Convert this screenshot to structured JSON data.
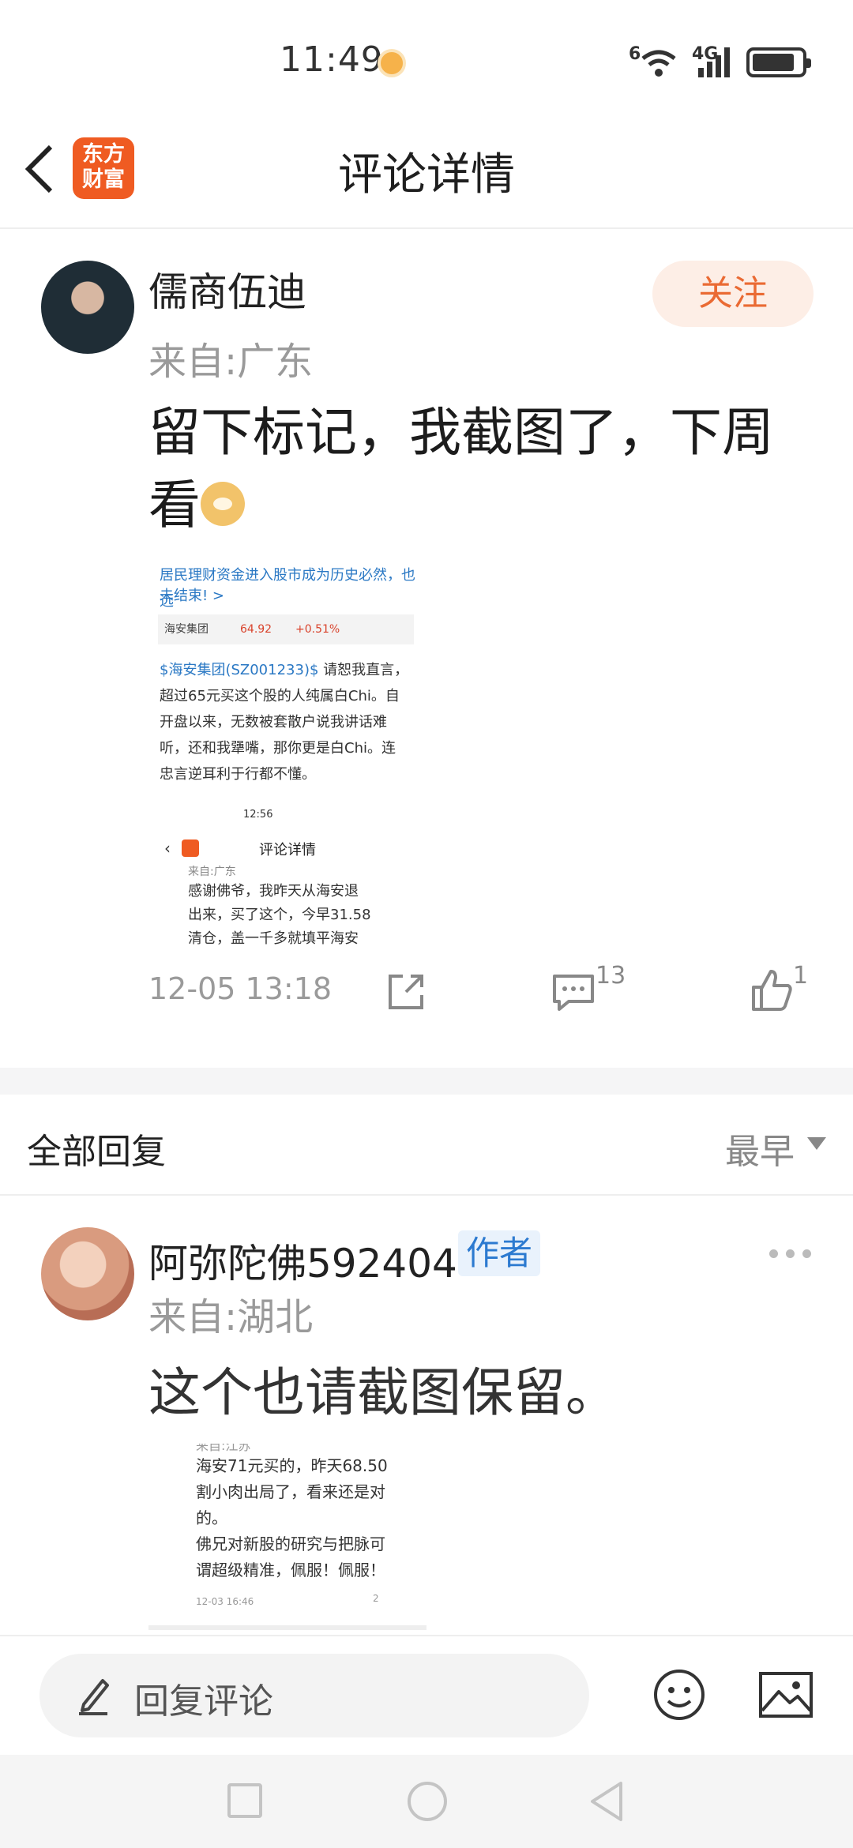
{
  "status_bar": {
    "time": "11:49",
    "wifi_label": "6",
    "cell_label": "4G"
  },
  "header": {
    "title": "评论详情",
    "logo_line1": "东方",
    "logo_line2": "财富"
  },
  "post": {
    "author": "儒商伍迪",
    "location": "来自:广东",
    "follow_label": "关注",
    "text": "留下标记，我截图了，下周看",
    "image": {
      "line1": "居民理财资金进入股市成为历史必然，也远",
      "line2": "未结束! >",
      "stock_name": "海安集团",
      "stock_price": "64.92",
      "stock_change": "+0.51%",
      "ticker": "$海安集团(SZ001233)$",
      "body_line1": " 请恕我直言，",
      "body_line2": "超过65元买这个股的人纯属白Chi。自",
      "body_line3": "开盘以来，无数被套散户说我讲话难",
      "body_line4": "听，还和我犟嘴，那你更是白Chi。连",
      "body_line5": "忠言逆耳利于行都不懂。",
      "mini_time": "12:56",
      "mini_title": "评论详情",
      "mini_location": "来自:广东",
      "mini_line1": "感谢佛爷，我昨天从海安退",
      "mini_line2": "出来，买了这个，今早31.58",
      "mini_line3": "清仓，盖一千多就填平海安"
    },
    "date": "12-05 13:18",
    "comment_count": "13",
    "like_count": "1"
  },
  "replies": {
    "label": "全部回复",
    "sort": "最早",
    "items": [
      {
        "author": "阿弥陀佛592404",
        "badge": "作者",
        "location": "来自:湖北",
        "text": "这个也请截图保留。",
        "image": {
          "line0": "来自:江苏",
          "line1": "海安71元买的，昨天68.50",
          "line2": "割小肉出局了，看来还是对",
          "line3": "的。",
          "line4": "佛兄对新股的研究与把脉可",
          "line5": "谓超级精准，佩服！佩服！",
          "date": "12-03 16:46",
          "comments": "2"
        }
      }
    ]
  },
  "bottom_bar": {
    "placeholder": "回复评论"
  },
  "colors": {
    "accent": "#ea6a33",
    "follow_bg": "#fdeee6",
    "badge_blue": "#2c7ad0",
    "logo": "#ef5b22"
  }
}
